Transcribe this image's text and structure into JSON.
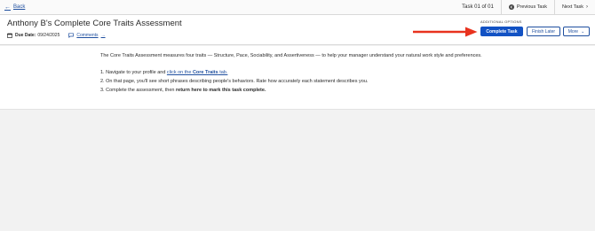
{
  "topbar": {
    "back_label": "Back",
    "task_count": "Task 01 of 01",
    "previous_task": "Previous Task",
    "next_task": "Next Task"
  },
  "header": {
    "title": "Anthony B's Complete Core Traits Assessment",
    "due_label": "Due Date:",
    "due_date": "09/24/2025",
    "comments": "Comments"
  },
  "actions": {
    "section_label": "ADDITIONAL OPTIONS",
    "complete": "Complete Task",
    "finish_later": "Finish Later",
    "more": "More"
  },
  "content": {
    "intro": "The Core Traits Assessment measures four traits — Structure, Pace, Sociability, and Assertiveness — to help your manager understand your natural work style and preferences.",
    "step1_prefix": "1. Navigate to your profile and ",
    "step1_link_prefix": "click on the ",
    "step1_link_bold": "Core Traits",
    "step1_link_suffix": " tab.",
    "step2": "2. On that page, you'll see short phrases describing people's behaviors. Rate how accurately each statement describes you.",
    "step3_prefix": "3. Complete the assessment, then ",
    "step3_bold": "return here to mark this task complete."
  },
  "colors": {
    "primary": "#1252c4",
    "link": "#1f4f9f",
    "annotation_arrow": "#e8321e"
  }
}
